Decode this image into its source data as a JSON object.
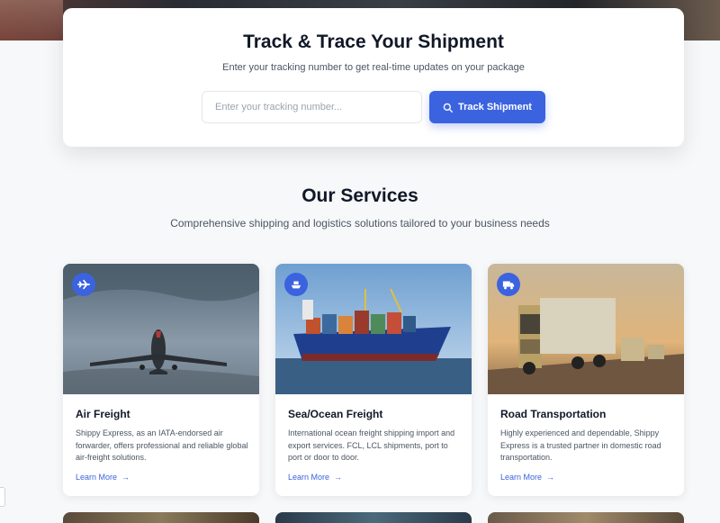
{
  "tracking": {
    "title": "Track & Trace Your Shipment",
    "subtitle": "Enter your tracking number to get real-time updates on your package",
    "input_placeholder": "Enter your tracking number...",
    "button_label": "Track Shipment"
  },
  "services": {
    "title": "Our Services",
    "subtitle": "Comprehensive shipping and logistics solutions tailored to your business needs",
    "items": [
      {
        "icon": "plane-icon",
        "title": "Air Freight",
        "description": "Shippy Express, as an IATA-endorsed air forwarder, offers professional and reliable global air-freight solutions.",
        "link": "Learn More"
      },
      {
        "icon": "ship-icon",
        "title": "Sea/Ocean Freight",
        "description": "International ocean freight shipping import and export services. FCL, LCL shipments, port to port or door to door.",
        "link": "Learn More"
      },
      {
        "icon": "truck-icon",
        "title": "Road Transportation",
        "description": "Highly experienced and dependable, Shippy Express is a trusted partner in domestic road transportation.",
        "link": "Learn More"
      }
    ]
  },
  "colors": {
    "accent": "#3b63e0",
    "background": "#f7f8fa"
  }
}
